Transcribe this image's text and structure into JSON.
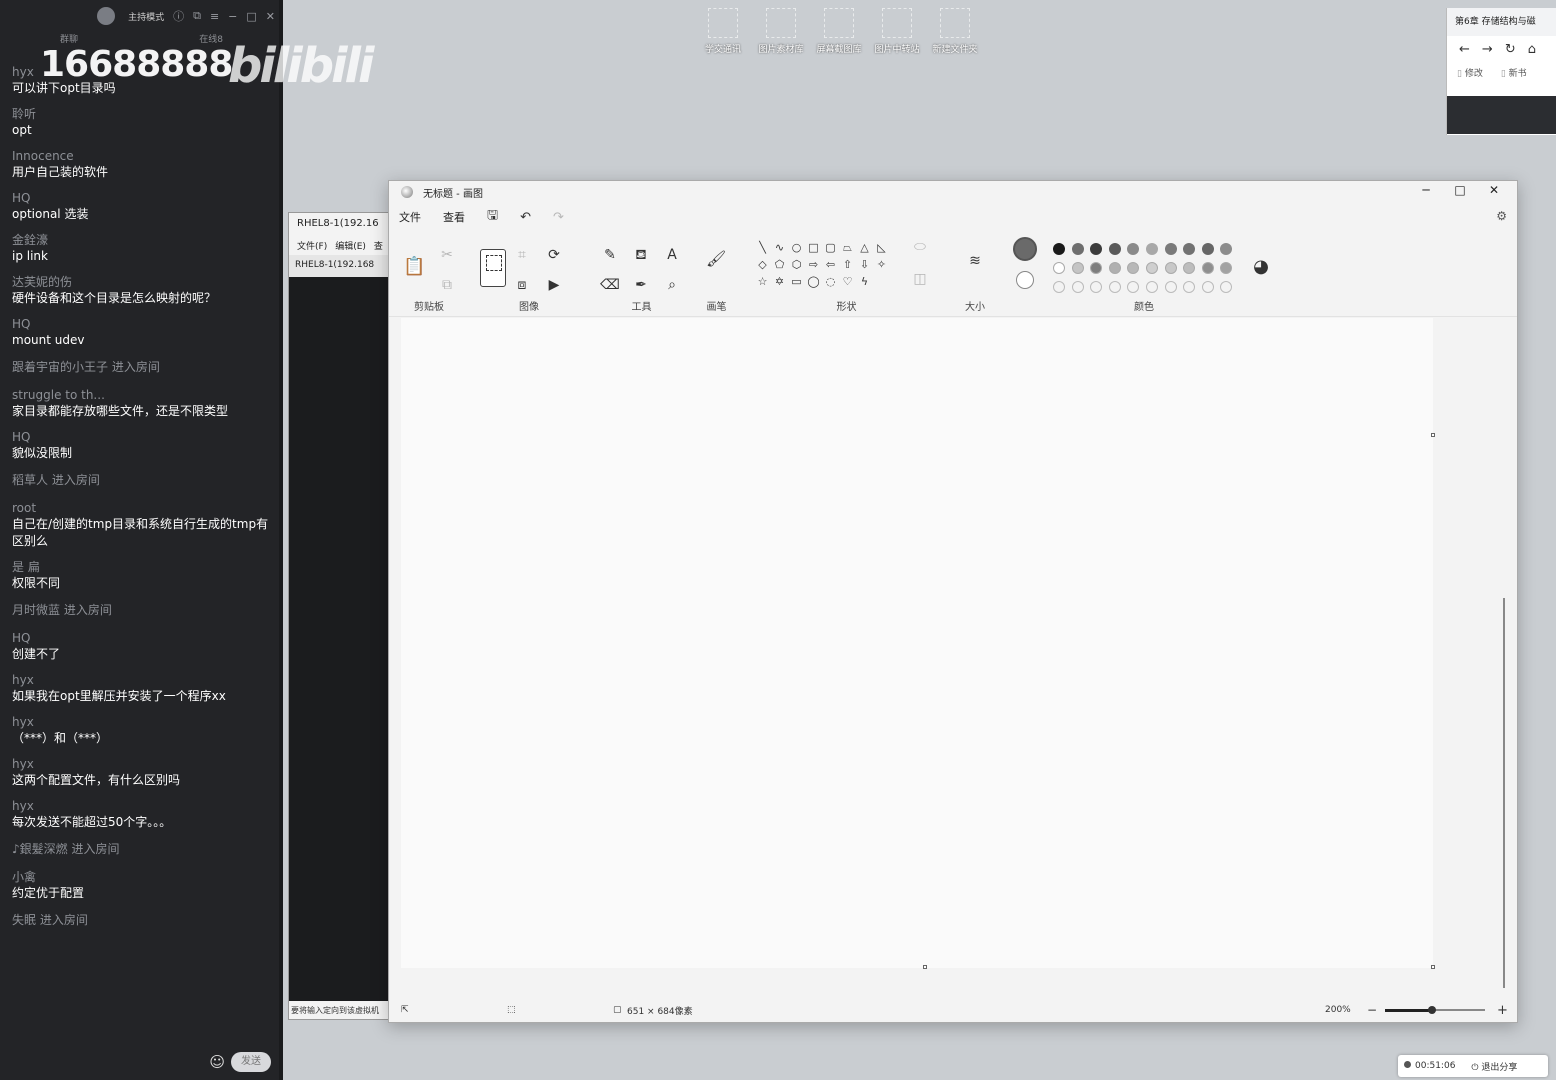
{
  "chat": {
    "mode": "主持模式",
    "sub_left": "群聊",
    "sub_right": "在线8",
    "messages": [
      {
        "user": "hyx",
        "text": "可以讲下opt目录吗"
      },
      {
        "user": "聆听",
        "text": "opt"
      },
      {
        "user": "Innocence",
        "text": "用户自己装的软件"
      },
      {
        "user": "HQ",
        "text": "optional 选装"
      },
      {
        "user": "金銓濠",
        "text": "ip link"
      },
      {
        "user": "达芙妮的伤",
        "text": "硬件设备和这个目录是怎么映射的呢？"
      },
      {
        "user": "HQ",
        "text": "mount udev"
      },
      {
        "user": "跟着宇宙的小王子",
        "enter": "进入房间"
      },
      {
        "user": "struggle to th...",
        "text": "家目录都能存放哪些文件，还是不限类型"
      },
      {
        "user": "HQ",
        "text": "貌似没限制"
      },
      {
        "user": "稻草人",
        "enter": "进入房间"
      },
      {
        "user": "root",
        "text": "自己在/创建的tmp目录和系统自行生成的tmp有区别么"
      },
      {
        "user": "是 扁",
        "text": "权限不同"
      },
      {
        "user": "月时微蓝",
        "enter": "进入房间"
      },
      {
        "user": "HQ",
        "text": "创建不了"
      },
      {
        "user": "hyx",
        "text": "如果我在opt里解压并安装了一个程序xx"
      },
      {
        "user": "hyx",
        "text": "（***）和（***）"
      },
      {
        "user": "hyx",
        "text": "这两个配置文件，有什么区别吗"
      },
      {
        "user": "hyx",
        "text": "每次发送不能超过50个字。。。"
      },
      {
        "user": "♪銀髮深燃",
        "enter": "进入房间"
      },
      {
        "user": "小禽",
        "text": "约定优于配置"
      },
      {
        "user": "失眠",
        "enter": "进入房间"
      }
    ],
    "send_label": "发送"
  },
  "watermark": {
    "number": "16688888",
    "logo": "bilibili"
  },
  "desktop_icons": [
    "学交通讯",
    "图片素材库",
    "屏幕截图库",
    "图片中转站",
    "新建文件夹"
  ],
  "browser": {
    "tab_title": "第6章 存储结构与磁",
    "bookmarks": [
      "修改",
      "新书"
    ]
  },
  "vm": {
    "title": "RHEL8-1(192.16",
    "menu": [
      "文件(F)",
      "编辑(E)",
      "查"
    ],
    "tab": "RHEL8-1(192.168",
    "status": "要将输入定向到该虚拟机"
  },
  "paint": {
    "title": "无标题 - 画图",
    "menu": {
      "file": "文件",
      "view": "查看"
    },
    "groups": {
      "clipboard": "剪贴板",
      "image": "图像",
      "tools": "工具",
      "brushes": "画笔",
      "shapes": "形状",
      "size": "大小",
      "colors": "颜色"
    },
    "palette_row1": [
      "#1a1a1a",
      "#6e6e6e",
      "#3c3c3c",
      "#5a5a5a",
      "#8a8a8a",
      "#a8a8a8",
      "#7a7a7a",
      "#727272",
      "#666666",
      "#8c8c8c"
    ],
    "palette_row2": [
      "#ffffff",
      "#c4c4c4",
      "#7e7e7e",
      "#b0b0b0",
      "#b8b8b8",
      "#cfcfcf",
      "#c8c8c8",
      "#bdbdbd",
      "#8f8f8f",
      "#a2a2a2"
    ],
    "status": {
      "canvas_size": "651 × 684像素",
      "zoom": "200%"
    }
  },
  "share": {
    "time": "00:51:06",
    "exit": "退出分享"
  }
}
